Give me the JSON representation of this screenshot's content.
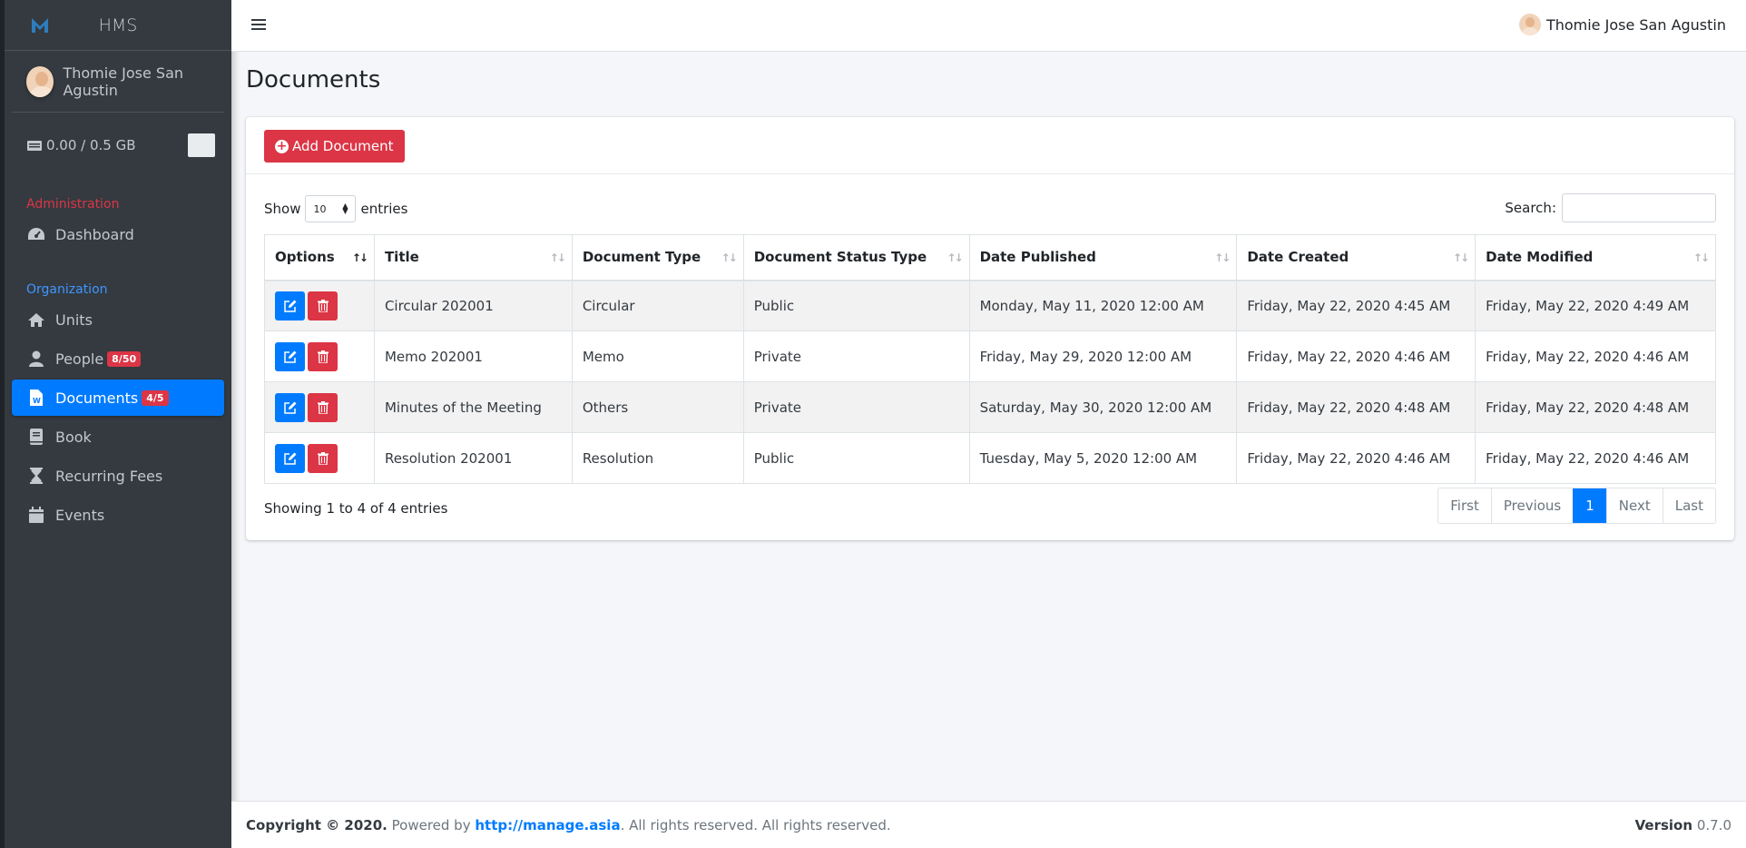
{
  "brand": {
    "name": "HMS"
  },
  "user": {
    "name": "Thomie Jose San Agustin"
  },
  "storage": {
    "text": "0.00 / 0.5 GB"
  },
  "sidebar": {
    "admin_header": "Administration",
    "org_header": "Organization",
    "items": [
      {
        "label": "Dashboard",
        "icon": "dashboard-icon"
      },
      {
        "label": "Units",
        "icon": "home-icon"
      },
      {
        "label": "People",
        "icon": "user-icon",
        "badge": "8/50"
      },
      {
        "label": "Documents",
        "icon": "word-file-icon",
        "badge": "4/5"
      },
      {
        "label": "Book",
        "icon": "book-icon"
      },
      {
        "label": "Recurring Fees",
        "icon": "hourglass-icon"
      },
      {
        "label": "Events",
        "icon": "calendar-icon"
      }
    ]
  },
  "page": {
    "title": "Documents"
  },
  "toolbar": {
    "add_label": "Add Document"
  },
  "datatable": {
    "show_label": "Show",
    "entries_value": "10",
    "entries_label": "entries",
    "search_label": "Search:",
    "search_value": "",
    "columns": [
      "Options",
      "Title",
      "Document Type",
      "Document Status Type",
      "Date Published",
      "Date Created",
      "Date Modified"
    ],
    "rows": [
      {
        "title": "Circular 202001",
        "type": "Circular",
        "status": "Public",
        "published": "Monday, May 11, 2020 12:00 AM",
        "created": "Friday, May 22, 2020 4:45 AM",
        "modified": "Friday, May 22, 2020 4:49 AM"
      },
      {
        "title": "Memo 202001",
        "type": "Memo",
        "status": "Private",
        "published": "Friday, May 29, 2020 12:00 AM",
        "created": "Friday, May 22, 2020 4:46 AM",
        "modified": "Friday, May 22, 2020 4:46 AM"
      },
      {
        "title": "Minutes of the Meeting",
        "type": "Others",
        "status": "Private",
        "published": "Saturday, May 30, 2020 12:00 AM",
        "created": "Friday, May 22, 2020 4:48 AM",
        "modified": "Friday, May 22, 2020 4:48 AM"
      },
      {
        "title": "Resolution 202001",
        "type": "Resolution",
        "status": "Public",
        "published": "Tuesday, May 5, 2020 12:00 AM",
        "created": "Friday, May 22, 2020 4:46 AM",
        "modified": "Friday, May 22, 2020 4:46 AM"
      }
    ],
    "info": "Showing 1 to 4 of 4 entries",
    "pager": {
      "first": "First",
      "previous": "Previous",
      "current": "1",
      "next": "Next",
      "last": "Last"
    }
  },
  "footer": {
    "copyright": "Copyright © 2020.",
    "powered_by": "Powered by",
    "link": "http://manage.asia",
    "rights": ". All rights reserved. All rights reserved.",
    "version_label": "Version",
    "version": "0.7.0"
  },
  "colors": {
    "sidebar": "#343a40",
    "primary": "#007bff",
    "danger": "#dc3545"
  }
}
